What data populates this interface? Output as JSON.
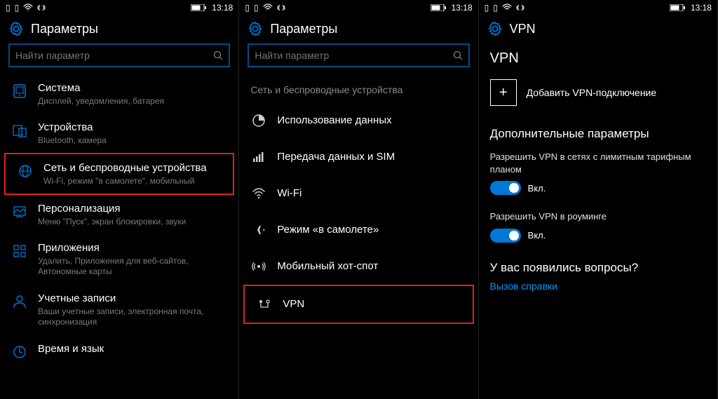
{
  "status_bar": {
    "time": "13:18"
  },
  "panel1": {
    "title": "Параметры",
    "search_placeholder": "Найти параметр",
    "items": [
      {
        "title": "Система",
        "sub": "Дисплей, уведомления, батарея"
      },
      {
        "title": "Устройства",
        "sub": "Bluetooth, камера"
      },
      {
        "title": "Сеть и беспроводные устройства",
        "sub": "Wi-Fi, режим \"в самолете\", мобильный"
      },
      {
        "title": "Персонализация",
        "sub": "Меню \"Пуск\", экран блокировки, звуки"
      },
      {
        "title": "Приложения",
        "sub": "Удалить, Приложения для веб-сайтов, Автономные карты"
      },
      {
        "title": "Учетные записи",
        "sub": "Ваши учетные записи, электронная почта, синхронизация"
      },
      {
        "title": "Время и язык",
        "sub": ""
      }
    ]
  },
  "panel2": {
    "title": "Параметры",
    "search_placeholder": "Найти параметр",
    "section_label": "Сеть и беспроводные устройства",
    "items": [
      {
        "title": "Использование данных"
      },
      {
        "title": "Передача данных и SIM"
      },
      {
        "title": "Wi-Fi"
      },
      {
        "title": "Режим «в самолете»"
      },
      {
        "title": "Мобильный хот-спот"
      },
      {
        "title": "VPN"
      }
    ]
  },
  "panel3": {
    "title": "VPN",
    "heading": "VPN",
    "add_label": "Добавить VPN-подключение",
    "extra_heading": "Дополнительные параметры",
    "setting1_label": "Разрешить VPN в сетях с лимитным тарифным планом",
    "setting1_state": "Вкл.",
    "setting2_label": "Разрешить VPN в роуминге",
    "setting2_state": "Вкл.",
    "questions": "У вас появились вопросы?",
    "help_link": "Вызов справки"
  }
}
